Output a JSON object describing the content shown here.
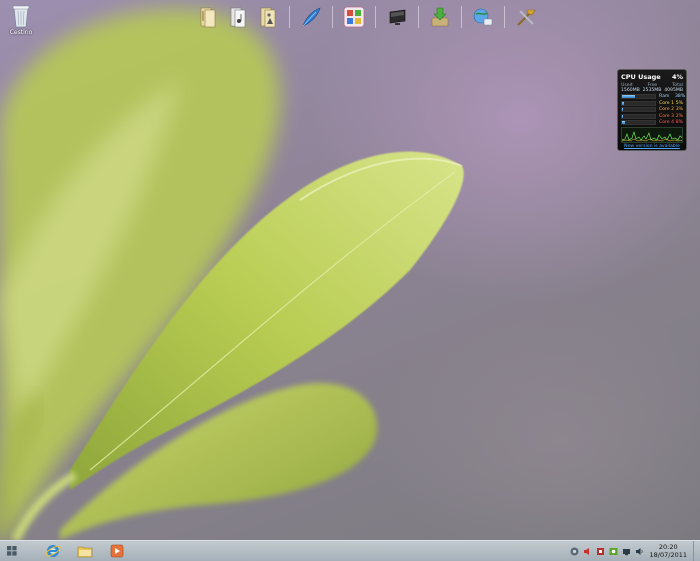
{
  "desktop": {
    "recycle_bin": {
      "label": "Cestino",
      "icon": "recycle-bin-icon"
    }
  },
  "dock": {
    "icons": [
      "documents-icon",
      "music-icon",
      "pictures-icon",
      "feather-icon",
      "control-panel-icon",
      "monitor-icon",
      "downloads-icon",
      "network-icon",
      "tools-icon"
    ]
  },
  "cpu_gadget": {
    "title": "CPU Usage",
    "total_pct": "4%",
    "col_used": "Used",
    "col_free": "Free",
    "col_total": "Total",
    "used": "1560MB",
    "free": "2535MB",
    "total": "4095MB",
    "rows": [
      {
        "name": "Ram",
        "pct": "38%",
        "level": 0.38
      },
      {
        "name": "Core 1",
        "pct": "5%",
        "level": 0.05
      },
      {
        "name": "Core 2",
        "pct": "3%",
        "level": 0.03
      },
      {
        "name": "Core 3",
        "pct": "2%",
        "level": 0.02
      },
      {
        "name": "Core 4",
        "pct": "8%",
        "level": 0.08
      }
    ],
    "link": "New version is available"
  },
  "taskbar": {
    "start_icon": "windows-start-icon",
    "pinned": [
      "internet-explorer-icon",
      "file-explorer-icon",
      "media-player-icon"
    ],
    "tray_icons": [
      "network-icon",
      "volume-icon",
      "security-icon",
      "nvidia-icon",
      "action-center-icon",
      "speaker-icon"
    ],
    "time": "20:20",
    "date": "18/07/2011"
  }
}
